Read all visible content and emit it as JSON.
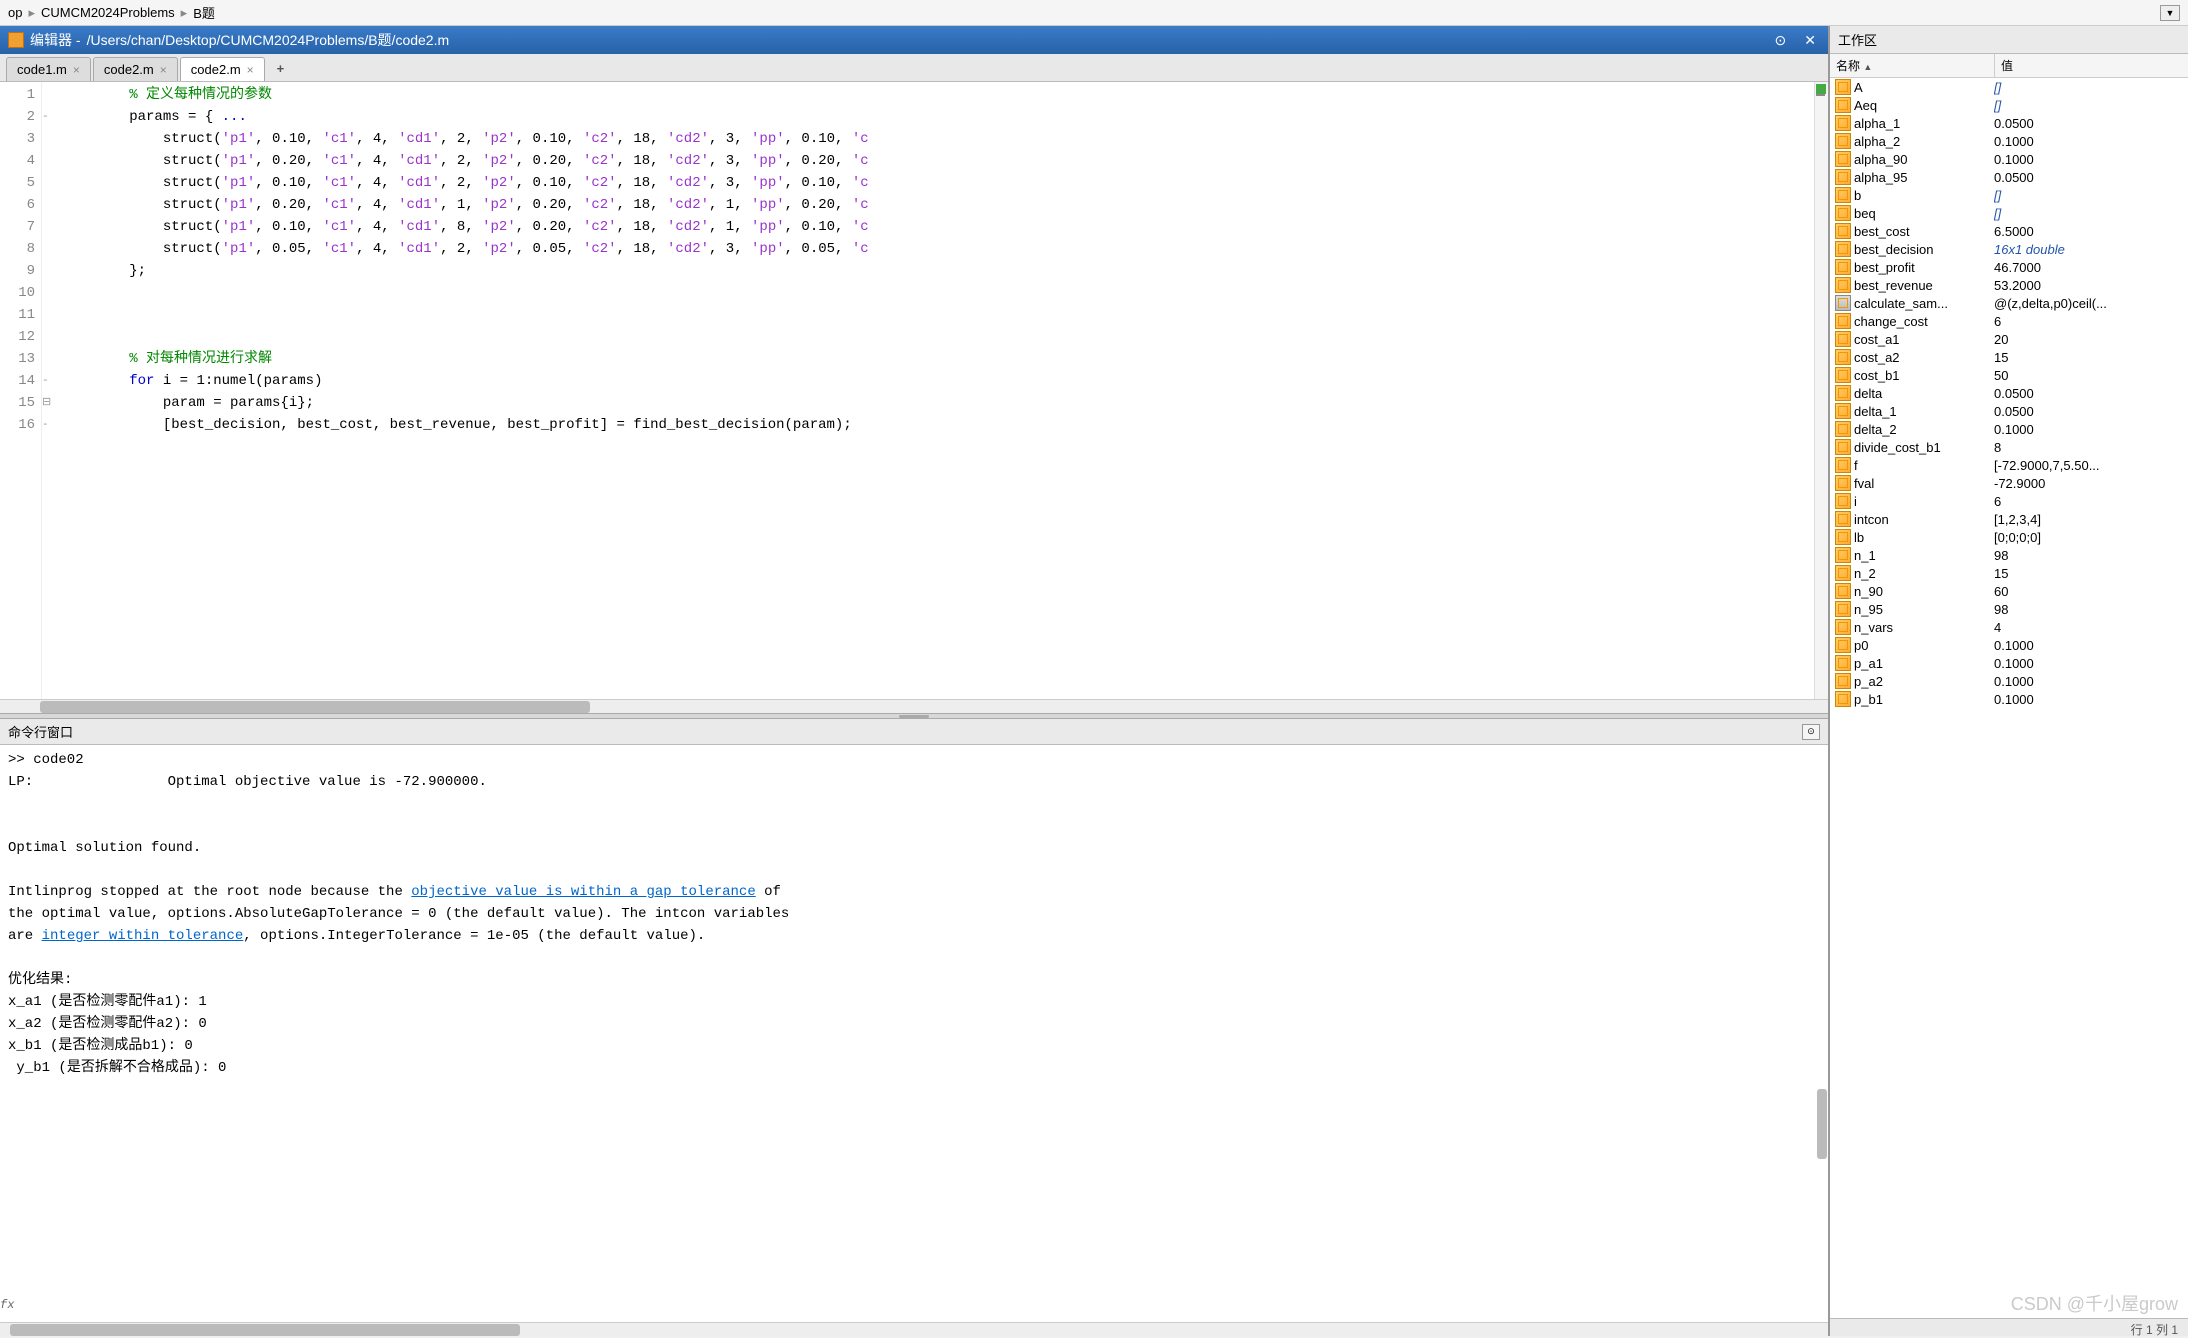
{
  "breadcrumb": {
    "items": [
      "op",
      "CUMCM2024Problems",
      "B题"
    ]
  },
  "editor": {
    "title_prefix": "编辑器 - ",
    "path": "/Users/chan/Desktop/CUMCM2024Problems/B题/code2.m",
    "tabs": [
      {
        "label": "code1.m",
        "active": false
      },
      {
        "label": "code2.m",
        "active": false
      },
      {
        "label": "code2.m",
        "active": true
      }
    ],
    "code_lines": [
      {
        "n": 1,
        "fold": "",
        "html": "        <span class='cm'>% 定义每种情况的参数</span>"
      },
      {
        "n": 2,
        "fold": "-",
        "html": "        params = { <span class='kw'>...</span>"
      },
      {
        "n": 3,
        "fold": "",
        "html": "            struct(<span class='str'>'p1'</span>, 0.10, <span class='str'>'c1'</span>, 4, <span class='str'>'cd1'</span>, 2, <span class='str'>'p2'</span>, 0.10, <span class='str'>'c2'</span>, 18, <span class='str'>'cd2'</span>, 3, <span class='str'>'pp'</span>, 0.10, <span class='str'>'c</span>"
      },
      {
        "n": 4,
        "fold": "",
        "html": "            struct(<span class='str'>'p1'</span>, 0.20, <span class='str'>'c1'</span>, 4, <span class='str'>'cd1'</span>, 2, <span class='str'>'p2'</span>, 0.20, <span class='str'>'c2'</span>, 18, <span class='str'>'cd2'</span>, 3, <span class='str'>'pp'</span>, 0.20, <span class='str'>'c</span>"
      },
      {
        "n": 5,
        "fold": "",
        "html": "            struct(<span class='str'>'p1'</span>, 0.10, <span class='str'>'c1'</span>, 4, <span class='str'>'cd1'</span>, 2, <span class='str'>'p2'</span>, 0.10, <span class='str'>'c2'</span>, 18, <span class='str'>'cd2'</span>, 3, <span class='str'>'pp'</span>, 0.10, <span class='str'>'c</span>"
      },
      {
        "n": 6,
        "fold": "",
        "html": "            struct(<span class='str'>'p1'</span>, 0.20, <span class='str'>'c1'</span>, 4, <span class='str'>'cd1'</span>, 1, <span class='str'>'p2'</span>, 0.20, <span class='str'>'c2'</span>, 18, <span class='str'>'cd2'</span>, 1, <span class='str'>'pp'</span>, 0.20, <span class='str'>'c</span>"
      },
      {
        "n": 7,
        "fold": "",
        "html": "            struct(<span class='str'>'p1'</span>, 0.10, <span class='str'>'c1'</span>, 4, <span class='str'>'cd1'</span>, 8, <span class='str'>'p2'</span>, 0.20, <span class='str'>'c2'</span>, 18, <span class='str'>'cd2'</span>, 1, <span class='str'>'pp'</span>, 0.10, <span class='str'>'c</span>"
      },
      {
        "n": 8,
        "fold": "",
        "html": "            struct(<span class='str'>'p1'</span>, 0.05, <span class='str'>'c1'</span>, 4, <span class='str'>'cd1'</span>, 2, <span class='str'>'p2'</span>, 0.05, <span class='str'>'c2'</span>, 18, <span class='str'>'cd2'</span>, 3, <span class='str'>'pp'</span>, 0.05, <span class='str'>'c</span>"
      },
      {
        "n": 9,
        "fold": "",
        "html": "        };"
      },
      {
        "n": 10,
        "fold": "",
        "html": ""
      },
      {
        "n": 11,
        "fold": "",
        "html": ""
      },
      {
        "n": 12,
        "fold": "",
        "html": ""
      },
      {
        "n": 13,
        "fold": "",
        "html": "        <span class='cm'>% 对每种情况进行求解</span>"
      },
      {
        "n": 14,
        "fold": "- ⊟",
        "html": "        <span class='kw'>for</span> i = 1:numel(params)"
      },
      {
        "n": 15,
        "fold": "-",
        "html": "            param = params{i};"
      },
      {
        "n": 16,
        "fold": "",
        "html": "            [best_decision, best_cost, best_revenue, best_profit] = find_best_decision(param);"
      }
    ]
  },
  "cmd": {
    "title": "命令行窗口",
    "lines": [
      ">> code02",
      "LP:                Optimal objective value is -72.900000.",
      "",
      "",
      "Optimal solution found.",
      "",
      "Intlinprog stopped at the root node because the <LINK1> of",
      "the optimal value, options.AbsoluteGapTolerance = 0 (the default value). The intcon variables",
      "are <LINK2>, options.IntegerTolerance = 1e-05 (the default value).",
      "",
      "优化结果:",
      "x_a1 (是否检测零配件a1): 1",
      "x_a2 (是否检测零配件a2): 0",
      "x_b1 (是否检测成品b1): 0",
      "y_b1 (是否拆解不合格成品): 0"
    ],
    "link1": "objective value is within a gap tolerance",
    "link2": "integer within tolerance"
  },
  "workspace": {
    "title": "工作区",
    "col_name": "名称",
    "col_value": "值",
    "vars": [
      {
        "name": "A",
        "value": "[]",
        "italic": true
      },
      {
        "name": "Aeq",
        "value": "[]",
        "italic": true
      },
      {
        "name": "alpha_1",
        "value": "0.0500"
      },
      {
        "name": "alpha_2",
        "value": "0.1000"
      },
      {
        "name": "alpha_90",
        "value": "0.1000"
      },
      {
        "name": "alpha_95",
        "value": "0.0500"
      },
      {
        "name": "b",
        "value": "[]",
        "italic": true
      },
      {
        "name": "beq",
        "value": "[]",
        "italic": true
      },
      {
        "name": "best_cost",
        "value": "6.5000"
      },
      {
        "name": "best_decision",
        "value": "16x1 double",
        "italic": true
      },
      {
        "name": "best_profit",
        "value": "46.7000"
      },
      {
        "name": "best_revenue",
        "value": "53.2000"
      },
      {
        "name": "calculate_sam...",
        "value": "@(z,delta,p0)ceil(...",
        "script": true
      },
      {
        "name": "change_cost",
        "value": "6"
      },
      {
        "name": "cost_a1",
        "value": "20"
      },
      {
        "name": "cost_a2",
        "value": "15"
      },
      {
        "name": "cost_b1",
        "value": "50"
      },
      {
        "name": "delta",
        "value": "0.0500"
      },
      {
        "name": "delta_1",
        "value": "0.0500"
      },
      {
        "name": "delta_2",
        "value": "0.1000"
      },
      {
        "name": "divide_cost_b1",
        "value": "8"
      },
      {
        "name": "f",
        "value": "[-72.9000,7,5.50..."
      },
      {
        "name": "fval",
        "value": "-72.9000"
      },
      {
        "name": "i",
        "value": "6"
      },
      {
        "name": "intcon",
        "value": "[1,2,3,4]"
      },
      {
        "name": "lb",
        "value": "[0;0;0;0]"
      },
      {
        "name": "n_1",
        "value": "98"
      },
      {
        "name": "n_2",
        "value": "15"
      },
      {
        "name": "n_90",
        "value": "60"
      },
      {
        "name": "n_95",
        "value": "98"
      },
      {
        "name": "n_vars",
        "value": "4"
      },
      {
        "name": "p0",
        "value": "0.1000"
      },
      {
        "name": "p_a1",
        "value": "0.1000"
      },
      {
        "name": "p_a2",
        "value": "0.1000"
      },
      {
        "name": "p_b1",
        "value": "0.1000"
      }
    ]
  },
  "status": {
    "text": "行 1   列 1"
  },
  "watermark": "CSDN @千小屋grow"
}
